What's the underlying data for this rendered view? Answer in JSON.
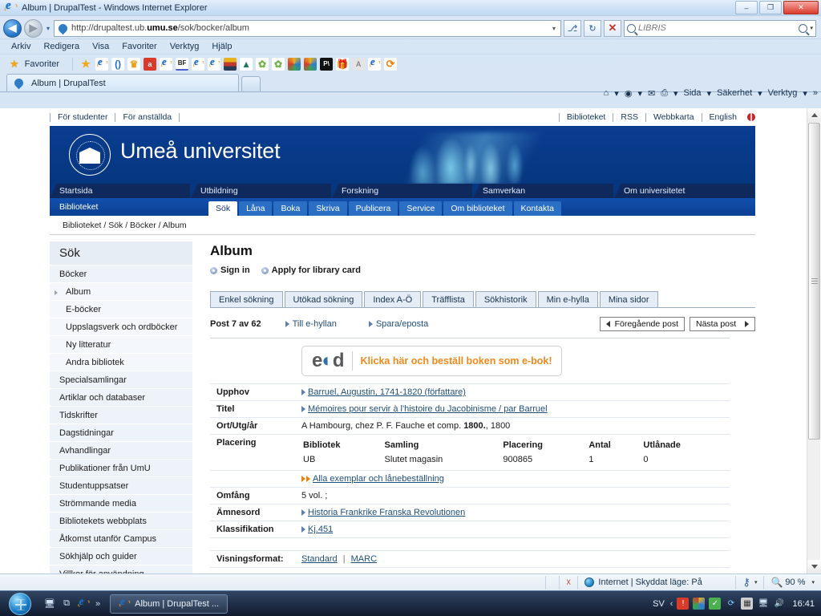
{
  "window": {
    "title": "Album | DrupalTest - Windows Internet Explorer",
    "minimize_label": "–",
    "maximize_label": "❐",
    "close_label": "✕"
  },
  "browser": {
    "address_url_plain": "http://drupaltest.ub.",
    "address_url_bold": "umu.se",
    "address_url_rest": "/sok/bocker/album",
    "address_caret": "▾",
    "back_label": "◀",
    "forward_label": "▶",
    "nav_history_caret": "▾",
    "compat_label": "⎇",
    "refresh_label": "↻",
    "stop_label": "✕",
    "search_placeholder": "LIBRIS",
    "search_caret": "▾",
    "menus": [
      "Arkiv",
      "Redigera",
      "Visa",
      "Favoriter",
      "Verktyg",
      "Hjälp"
    ],
    "favorites_label": "Favoriter",
    "tab_title": "Album | DrupalTest",
    "command_bar": {
      "home": "⌂",
      "feeds": "◉",
      "mail": "✉",
      "print": "⎙",
      "page": "Sida",
      "safety": "Säkerhet",
      "tools": "Verktyg",
      "overflow": "»",
      "caret": "▾"
    }
  },
  "topnav": {
    "left": [
      "För studenter",
      "För anställda"
    ],
    "right": [
      "Biblioteket",
      "RSS",
      "Webbkarta",
      "English"
    ]
  },
  "banner": {
    "title": "Umeå universitet",
    "seal_text": "UMEA UNIVERSITET"
  },
  "mainnav": [
    "Startsida",
    "Utbildning",
    "Forskning",
    "Samverkan",
    "Om universitetet"
  ],
  "subnav": {
    "brand": "Biblioteket",
    "items": [
      "Sök",
      "Låna",
      "Boka",
      "Skriva",
      "Publicera",
      "Service",
      "Om biblioteket",
      "Kontakta"
    ],
    "active": "Sök"
  },
  "breadcrumb": "Biblioteket / Sök / Böcker / Album",
  "sidebar": {
    "heading": "Sök",
    "items": [
      {
        "label": "Böcker",
        "sub": false,
        "active": false
      },
      {
        "label": "Album",
        "sub": true,
        "active": true
      },
      {
        "label": "E-böcker",
        "sub": true,
        "active": false
      },
      {
        "label": "Uppslagsverk och ordböcker",
        "sub": true,
        "active": false
      },
      {
        "label": "Ny litteratur",
        "sub": true,
        "active": false
      },
      {
        "label": "Andra bibliotek",
        "sub": true,
        "active": false
      },
      {
        "label": "Specialsamlingar",
        "sub": false,
        "active": false
      },
      {
        "label": "Artiklar och databaser",
        "sub": false,
        "active": false
      },
      {
        "label": "Tidskrifter",
        "sub": false,
        "active": false
      },
      {
        "label": "Dagstidningar",
        "sub": false,
        "active": false
      },
      {
        "label": "Avhandlingar",
        "sub": false,
        "active": false
      },
      {
        "label": "Publikationer från UmU",
        "sub": false,
        "active": false
      },
      {
        "label": "Studentuppsatser",
        "sub": false,
        "active": false
      },
      {
        "label": "Strömmande media",
        "sub": false,
        "active": false
      },
      {
        "label": "Bibliotekets webbplats",
        "sub": false,
        "active": false
      },
      {
        "label": "Åtkomst utanför Campus",
        "sub": false,
        "active": false
      },
      {
        "label": "Sökhjälp och guider",
        "sub": false,
        "active": false
      },
      {
        "label": "Villkor för användning",
        "sub": false,
        "active": false
      }
    ]
  },
  "main": {
    "page_title": "Album",
    "sign_in": "Sign in",
    "apply_card": "Apply for library card",
    "tabs": [
      "Enkel sökning",
      "Utökad sökning",
      "Index A-Ö",
      "Träfflista",
      "Sökhistorik",
      "Min e-hylla",
      "Mina sidor"
    ],
    "post_counter": "Post 7 av 62",
    "to_eshelf": "Till e-hyllan",
    "save_email": "Spara/eposta",
    "prev_post": "Föregående post",
    "next_post": "Nästa post",
    "eod": {
      "logo_e": "e",
      "logo_o": "◐",
      "logo_d": "d",
      "text": "Klicka här och beställ boken som e-bok!"
    },
    "record": {
      "upphov_label": "Upphov",
      "upphov_value": "Barruel, Augustin, 1741-1820 (författare)",
      "titel_label": "Titel",
      "titel_value": "Mémoires pour servir à l'histoire du Jacobinisme / par Barruel",
      "ort_label": "Ort/Utg/år",
      "ort_value_pre": "A Hambourg, chez P. F. Fauche et comp. ",
      "ort_value_bold": "1800.",
      "ort_value_post": ", 1800",
      "placering_label": "Placering",
      "holdings_headers": [
        "Bibliotek",
        "Samling",
        "Placering",
        "Antal",
        "Utlånade"
      ],
      "holdings_rows": [
        [
          "UB",
          "Slutet magasin",
          "900865",
          "1",
          "0"
        ]
      ],
      "all_copies_link": "Alla exemplar och lånebeställning",
      "omfang_label": "Omfång",
      "omfang_value": "5 vol. ;",
      "amnesord_label": "Ämnesord",
      "amnesord_value": "Historia Frankrike Franska Revolutionen",
      "klassifikation_label": "Klassifikation",
      "klassifikation_value": "Kj.451",
      "visningsformat_label": "Visningsformat:",
      "visningsformat_standard": "Standard",
      "visningsformat_sep": "|",
      "visningsformat_marc": "MARC"
    }
  },
  "statusbar": {
    "zone": "Internet | Skyddat läge: På",
    "zoom": "90 %",
    "zoom_caret": "▾",
    "protected_caret": "▾"
  },
  "taskbar": {
    "task_label": "Album | DrupalTest ...",
    "language": "SV",
    "clock": "16:41",
    "tray_chevron": "‹",
    "quicklaunch_chevron": "»"
  },
  "colors": {
    "banner_blue": "#06367f",
    "nav_blue": "#2a6fc4",
    "link_blue": "#1f4e79",
    "eod_orange": "#f0891b",
    "sidebar_bg": "#eef3f9"
  }
}
